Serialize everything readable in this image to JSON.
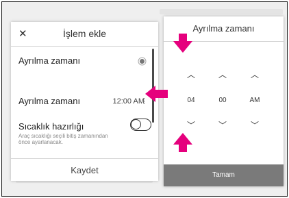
{
  "dialog": {
    "close_icon": "close-icon",
    "title": "İşlem ekle",
    "row1_label": "Ayrılma zamanı",
    "row2_label": "Ayrılma zamanı",
    "row2_time": "12:00 AM",
    "row3_label": "Sıcaklık hazırlığı",
    "row3_sub": "Araç sıcaklığı seçili bitiş zamanından önce ayarlanacak.",
    "save_label": "Kaydet"
  },
  "picker": {
    "title": "Ayrılma zamanı",
    "hour": "04",
    "minute": "00",
    "ampm": "AM",
    "ok_label": "Tamam"
  },
  "colors": {
    "highlight_arrow": "#e5007d",
    "ok_button": "#7a7a7a"
  }
}
